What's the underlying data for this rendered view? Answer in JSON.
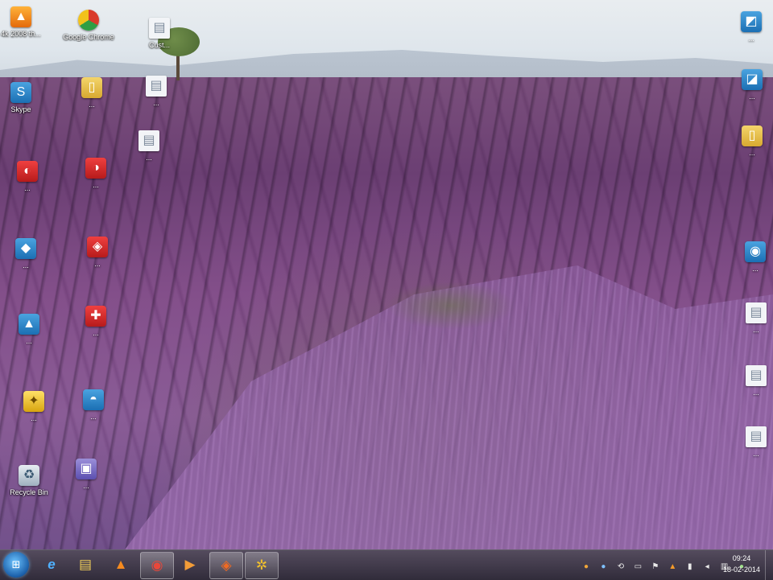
{
  "desktop": {
    "icons": [
      {
        "id": "vlc",
        "label": "4k 2008 th..."
      },
      {
        "id": "chrome",
        "label": "Google Chrome"
      },
      {
        "id": "doc-top",
        "label": "Cust..."
      },
      {
        "id": "skype",
        "label": "Skype"
      },
      {
        "id": "folder",
        "label": "..."
      },
      {
        "id": "doc-2",
        "label": "..."
      },
      {
        "id": "doc-3",
        "label": "..."
      },
      {
        "id": "app-1",
        "label": "..."
      },
      {
        "id": "app-2",
        "label": "..."
      },
      {
        "id": "app-3",
        "label": "..."
      },
      {
        "id": "app-4",
        "label": "..."
      },
      {
        "id": "app-5",
        "label": "..."
      },
      {
        "id": "app-6",
        "label": "..."
      },
      {
        "id": "app-7",
        "label": "..."
      },
      {
        "id": "app-8",
        "label": "..."
      },
      {
        "id": "recycle",
        "label": "Recycle Bin"
      },
      {
        "id": "app-9",
        "label": "..."
      },
      {
        "id": "right-1",
        "label": "..."
      },
      {
        "id": "right-2",
        "label": "..."
      },
      {
        "id": "right-3",
        "label": "..."
      },
      {
        "id": "right-4",
        "label": "..."
      },
      {
        "id": "right-5",
        "label": "..."
      },
      {
        "id": "right-6",
        "label": "..."
      },
      {
        "id": "right-7",
        "label": "..."
      }
    ]
  },
  "taskbar": {
    "pins": [
      {
        "id": "ie",
        "glyph": "e"
      },
      {
        "id": "explorer",
        "glyph": "▤"
      },
      {
        "id": "vlc",
        "glyph": "▲"
      },
      {
        "id": "chrome",
        "glyph": "◉"
      },
      {
        "id": "media",
        "glyph": "▶"
      },
      {
        "id": "app",
        "glyph": "◈"
      },
      {
        "id": "app2",
        "glyph": "✲"
      }
    ],
    "clock": {
      "time": "09:24",
      "date": "18-02-2014"
    }
  },
  "colors": {
    "taskbar": "#2e2838",
    "start_orb": "#1a5ea8",
    "lavender": "#8a5c96"
  }
}
